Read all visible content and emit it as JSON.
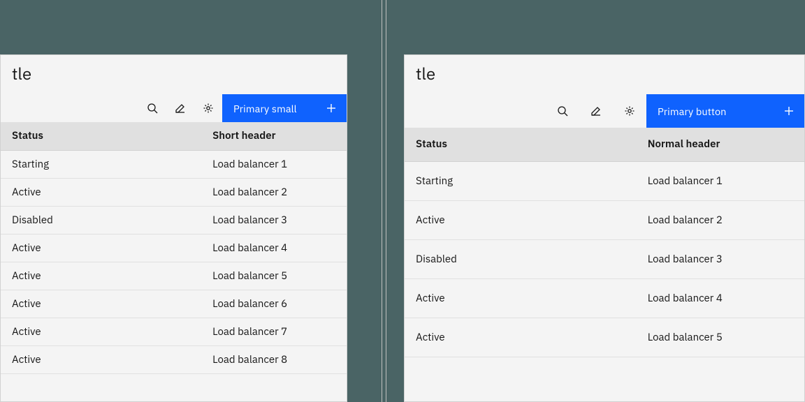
{
  "left": {
    "title": "tle",
    "primary_label": "Primary small",
    "columns": {
      "status": "Status",
      "name": "Short header"
    },
    "rows": [
      {
        "status": "Starting",
        "name": "Load balancer 1"
      },
      {
        "status": "Active",
        "name": "Load balancer 2"
      },
      {
        "status": "Disabled",
        "name": "Load balancer 3"
      },
      {
        "status": "Active",
        "name": "Load balancer 4"
      },
      {
        "status": "Active",
        "name": "Load balancer 5"
      },
      {
        "status": "Active",
        "name": "Load balancer 6"
      },
      {
        "status": "Active",
        "name": "Load balancer 7"
      },
      {
        "status": "Active",
        "name": "Load balancer 8"
      }
    ]
  },
  "right": {
    "title": "tle",
    "primary_label": "Primary button",
    "columns": {
      "status": "Status",
      "name": "Normal header"
    },
    "rows": [
      {
        "status": "Starting",
        "name": "Load balancer 1"
      },
      {
        "status": "Active",
        "name": "Load balancer 2"
      },
      {
        "status": "Disabled",
        "name": "Load balancer 3"
      },
      {
        "status": "Active",
        "name": "Load balancer 4"
      },
      {
        "status": "Active",
        "name": "Load balancer 5"
      }
    ]
  },
  "colors": {
    "accent": "#0f62fe",
    "bg": "#4a6465"
  }
}
